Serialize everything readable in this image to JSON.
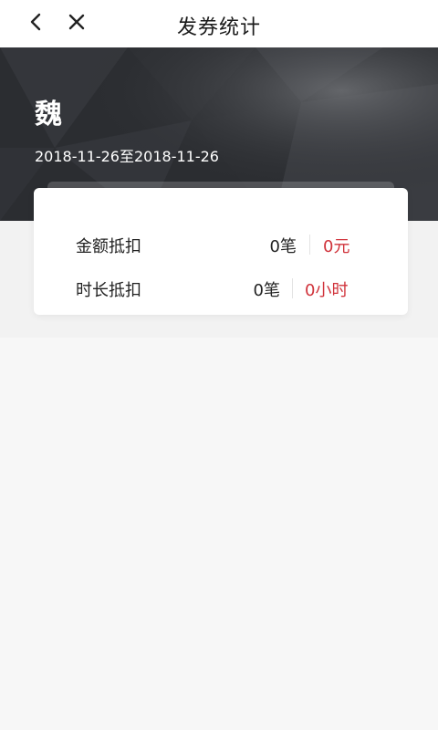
{
  "header": {
    "title": "发券统计",
    "back_icon": "chevron-left-icon",
    "close_icon": "close-icon"
  },
  "hero": {
    "name": "魏",
    "date_range": "2018-11-26至2018-11-26"
  },
  "stats": [
    {
      "label": "金额抵扣",
      "count": "0笔",
      "value": "0元"
    },
    {
      "label": "时长抵扣",
      "count": "0笔",
      "value": "0小时"
    }
  ],
  "colors": {
    "accent": "#d0333b",
    "hero_bg": "#2a2c30"
  }
}
